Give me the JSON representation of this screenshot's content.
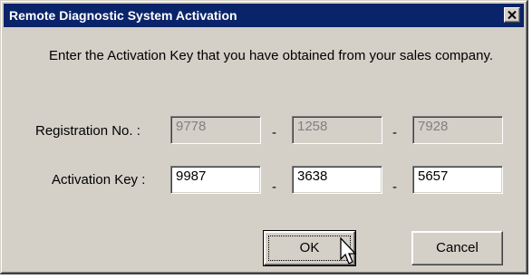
{
  "window": {
    "title": "Remote Diagnostic System Activation",
    "close_icon": "close-icon"
  },
  "instructions": "Enter the Activation Key that you have obtained from your sales company.",
  "registration": {
    "label": "Registration No. :",
    "part1": "9778",
    "part2": "1258",
    "part3": "7928",
    "separator": "-"
  },
  "activation": {
    "label": "Activation Key :",
    "part1": "9987",
    "part2": "3638",
    "part3": "5657",
    "separator": "-"
  },
  "buttons": {
    "ok": "OK",
    "cancel": "Cancel"
  },
  "colors": {
    "titlebar": "#0a246a",
    "dialog_bg": "#d4d0c8"
  }
}
